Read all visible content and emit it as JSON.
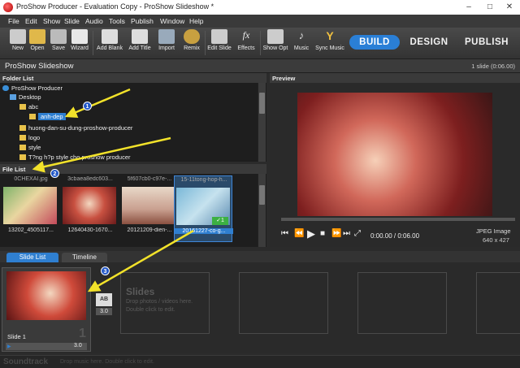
{
  "window": {
    "title": "ProShow Producer - Evaluation Copy - ProShow Slideshow *"
  },
  "menu": [
    "File",
    "Edit",
    "Show",
    "Slide",
    "Audio",
    "Tools",
    "Publish",
    "Window",
    "Help"
  ],
  "toolbar": {
    "buttons": [
      "New",
      "Open",
      "Save",
      "Wizard",
      "Add Blank",
      "Add Title",
      "Import",
      "Remix",
      "Edit Slide",
      "Effects",
      "Show Opt",
      "Music",
      "Sync Music"
    ],
    "modes": [
      "BUILD",
      "DESIGN",
      "PUBLISH"
    ]
  },
  "docbar": {
    "title": "ProShow Slideshow",
    "info": "1 slide (0:06.00)"
  },
  "folder": {
    "header": "Folder List",
    "items": [
      "ProShow Producer",
      "Desktop",
      "abc",
      "anh-dep",
      "huong-dan-su-dung-proshow-producer",
      "logo",
      "style",
      "T?ng h?p style cho proshow producer"
    ]
  },
  "filelist": {
    "header": "File List",
    "top_names": [
      "0CHEXAI.jpg",
      "3cbaea8edc603...",
      "5f607cb0-c97e-...",
      "15-11tong-hop-h..."
    ],
    "files": [
      "13202_4505117...",
      "12640430-1670...",
      "20121209-dien-...",
      "20161227-co-g..."
    ],
    "badge": "1"
  },
  "preview": {
    "header": "Preview",
    "time": "0:00.00 / 0:06.00",
    "type": "JPEG Image",
    "size": "640 x 427"
  },
  "tabs": {
    "slide_list": "Slide List",
    "timeline": "Timeline"
  },
  "slides": {
    "slide1_label": "Slide 1",
    "slide1_num": "1",
    "slide1_duration": "3.0",
    "transition_duration": "3.0",
    "empty_title": "Slides",
    "empty_hint1": "Drop photos / videos here.",
    "empty_hint2": "Double click to edit."
  },
  "soundtrack": {
    "label": "Soundtrack",
    "hint": "Drop music here.  Double click to edit."
  },
  "callouts": [
    "1",
    "2",
    "3"
  ]
}
